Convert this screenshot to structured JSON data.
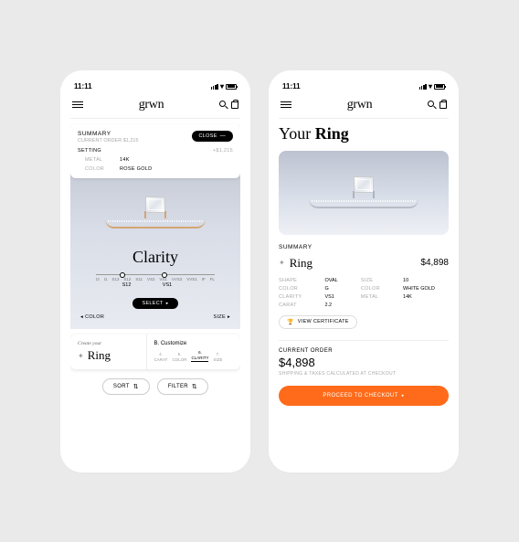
{
  "status": {
    "time": "11:11"
  },
  "brand": "grwn",
  "p1": {
    "summary": {
      "label": "SUMMARY",
      "sub": "CURRENT ORDER $1,215",
      "close": "CLOSE",
      "setting": "SETTING",
      "setting_price": "+$1,215",
      "metal_k": "METAL",
      "metal_v": "14K",
      "color_k": "COLOR",
      "color_v": "ROSE GOLD"
    },
    "config": {
      "title": "Clarity",
      "ticks": [
        "I2",
        "I1",
        "S13",
        "S12",
        "S11",
        "VS2",
        "VS1",
        "VVS2",
        "VVS1",
        "IF",
        "FL"
      ],
      "sel_a": "S12",
      "sel_b": "VS1",
      "select": "SELECT",
      "prev": "COLOR",
      "next": "SIZE"
    },
    "bottom": {
      "create": "Create your",
      "ring": "Ring",
      "bstep": "B. Customize",
      "steps": [
        {
          "n": "4.",
          "l": "CARAT"
        },
        {
          "n": "5.",
          "l": "COLOR"
        },
        {
          "n": "6.",
          "l": "CLARITY"
        },
        {
          "n": "7.",
          "l": "SIZE"
        }
      ],
      "active": 2
    },
    "filters": {
      "sort": "SORT",
      "filter": "FILTER"
    }
  },
  "p2": {
    "title_a": "Your ",
    "title_b": "Ring",
    "summary": "SUMMARY",
    "ring": "Ring",
    "price": "$4,898",
    "specs": [
      {
        "k": "SHAPE",
        "v": "OVAL"
      },
      {
        "k": "SIZE",
        "v": "10"
      },
      {
        "k": "COLOR",
        "v": "G"
      },
      {
        "k": "COLOR",
        "v": "WHITE GOLD"
      },
      {
        "k": "CLARITY",
        "v": "VS1"
      },
      {
        "k": "METAL",
        "v": "14K"
      },
      {
        "k": "CARAT",
        "v": "2.2"
      }
    ],
    "cert": "VIEW CERTIFICATE",
    "order": {
      "label": "CURRENT ORDER",
      "price": "$4,898",
      "ship": "SHIPPING & TAXES CALCULATED AT CHECKOUT",
      "checkout": "PROCEED TO CHECKOUT"
    }
  }
}
